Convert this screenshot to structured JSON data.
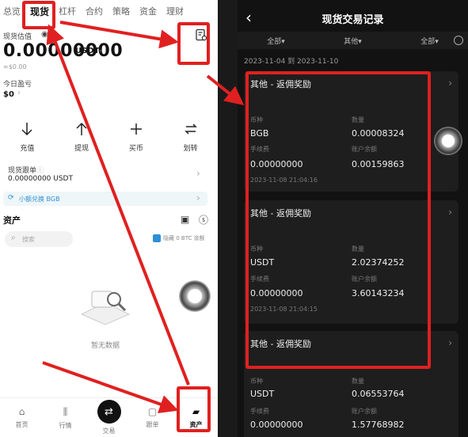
{
  "left": {
    "tabs": [
      "总览",
      "现货",
      "杠杆",
      "合约",
      "策略",
      "资金",
      "理财"
    ],
    "valuation_label": "现货估值",
    "amount": "0.00000000",
    "unit": "USDT",
    "approx": "≈$0.00",
    "pnl_label": "今日盈亏",
    "pnl_value": "$0",
    "actions": [
      {
        "label": "充值",
        "icon": "arrow-down-icon"
      },
      {
        "label": "提现",
        "icon": "arrow-up-icon"
      },
      {
        "label": "买币",
        "icon": "plus-icon"
      },
      {
        "label": "划转",
        "icon": "transfer-icon"
      }
    ],
    "spot_account_label": "现货跟单",
    "spot_account_value": "0.00000000 USDT",
    "banner_text": "小额兑换 BGB",
    "assets_title": "资产",
    "search_placeholder": "搜索",
    "hide_small_label": "隐藏 0 BTC 余额",
    "empty_text": "暂无数据",
    "nav": [
      {
        "label": "首页",
        "icon": "home-icon"
      },
      {
        "label": "行情",
        "icon": "market-icon"
      },
      {
        "label": "交易",
        "icon": "trade-icon"
      },
      {
        "label": "跟单",
        "icon": "copy-icon"
      },
      {
        "label": "资产",
        "icon": "wallet-icon"
      }
    ]
  },
  "right": {
    "title": "现货交易记录",
    "filters": [
      "全部▾",
      "其他▾",
      "全部▾"
    ],
    "date_range": "2023-11-04  到  2023-11-10",
    "field_labels": {
      "coin": "币种",
      "qty": "数量",
      "fee": "手续费",
      "balance": "账户余额"
    },
    "records": [
      {
        "type": "其他 - 返佣奖励",
        "coin": "BGB",
        "qty": "0.00008324",
        "fee": "0.00000000",
        "balance": "0.00159863",
        "time": "2023-11-08 21:04:16"
      },
      {
        "type": "其他 - 返佣奖励",
        "coin": "USDT",
        "qty": "2.02374252",
        "fee": "0.00000000",
        "balance": "3.60143234",
        "time": "2023-11-08 21:04:15"
      },
      {
        "type": "其他 - 返佣奖励",
        "coin": "USDT",
        "qty": "0.06553764",
        "fee": "0.00000000",
        "balance": "1.57768982",
        "time": ""
      }
    ]
  },
  "colors": {
    "highlight": "#e02020",
    "dark_bg": "#121212",
    "card_bg": "#1e1e1e",
    "accent_blue": "#2e8fd6"
  }
}
